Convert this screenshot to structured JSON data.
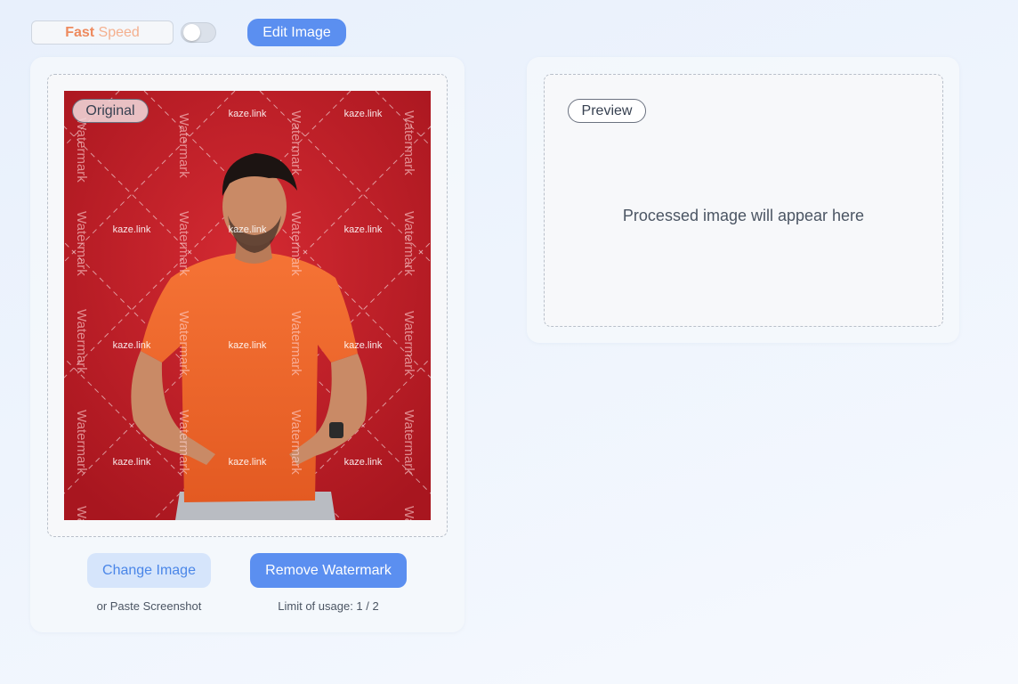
{
  "toolbar": {
    "speed_word1": "Fast",
    "speed_word2": "Speed",
    "speed_toggle_on": false,
    "edit_label": "Edit Image"
  },
  "original": {
    "badge": "Original",
    "watermark_text": "Watermark",
    "watermark_link": "kaze.link"
  },
  "actions": {
    "change_label": "Change Image",
    "paste_hint": "or Paste Screenshot",
    "remove_label": "Remove Watermark",
    "usage_text": "Limit of usage: 1 / 2"
  },
  "preview": {
    "badge": "Preview",
    "placeholder": "Processed image will appear here"
  },
  "colors": {
    "accent": "#5b8ff0",
    "photo_background": "#c3212b",
    "shirt": "#f06a2e"
  }
}
